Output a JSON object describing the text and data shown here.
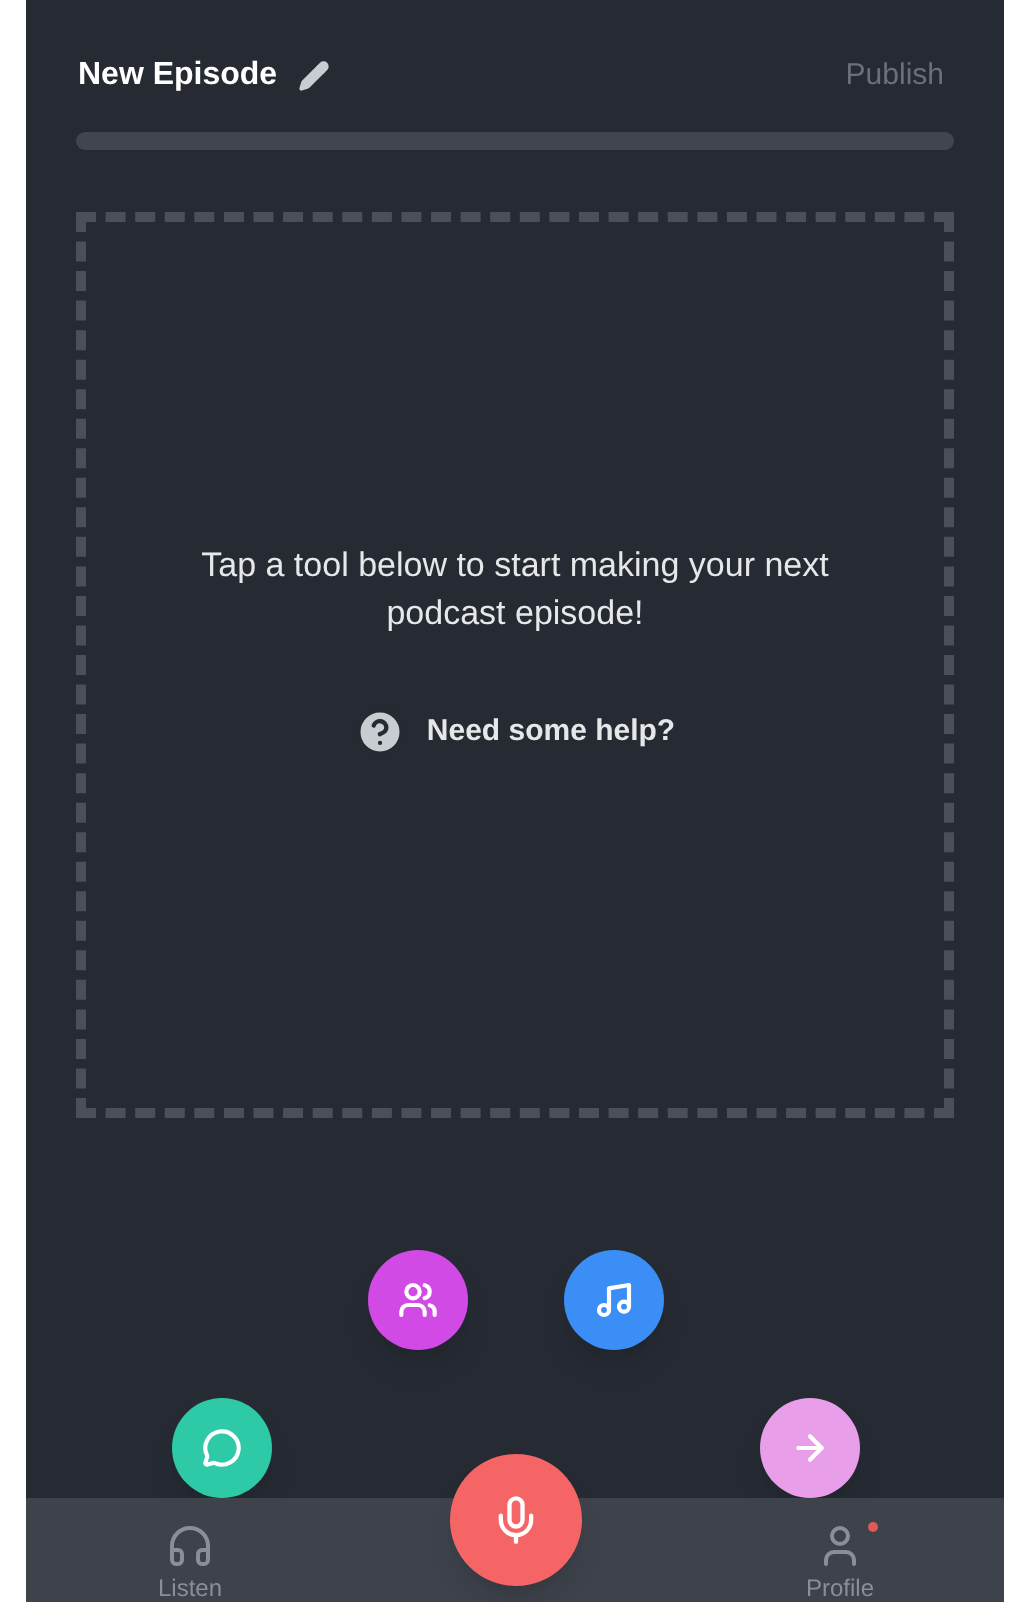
{
  "header": {
    "title": "New Episode",
    "action": "Publish"
  },
  "empty_state": {
    "message": "Tap a tool below to start making your next podcast episode!",
    "help": "Need some help?"
  },
  "tools": [
    {
      "kind": "comment",
      "color": "#2ec9a7"
    },
    {
      "kind": "guest",
      "color": "#d24ae6"
    },
    {
      "kind": "music",
      "color": "#3b8ef5"
    },
    {
      "kind": "next",
      "color": "#e89ee9"
    }
  ],
  "nav": [
    {
      "kind": "listen",
      "label": "Listen",
      "notification": false
    },
    {
      "kind": "record"
    },
    {
      "kind": "profile",
      "label": "Profile",
      "notification": true
    }
  ]
}
